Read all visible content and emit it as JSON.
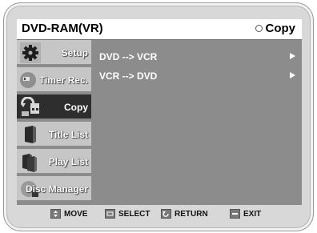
{
  "header": {
    "title": "DVD-RAM(VR)",
    "mode": "Copy",
    "mode_icon": "ring-icon"
  },
  "sidebar": {
    "items": [
      {
        "label": "Setup",
        "icon": "gear-icon",
        "active": false
      },
      {
        "label": "Timer Rec.",
        "icon": "clock-icon",
        "active": false
      },
      {
        "label": "Copy",
        "icon": "copy-icon",
        "active": true
      },
      {
        "label": "Title List",
        "icon": "title-list-icon",
        "active": false
      },
      {
        "label": "Play List",
        "icon": "play-list-icon",
        "active": false
      },
      {
        "label": "Disc Manager",
        "icon": "disc-icon",
        "active": false
      }
    ]
  },
  "menu": {
    "items": [
      {
        "label": "DVD --> VCR"
      },
      {
        "label": "VCR --> DVD"
      }
    ]
  },
  "footer": {
    "move": "MOVE",
    "select": "SELECT",
    "return": "RETURN",
    "exit": "EXIT"
  },
  "colors": {
    "panel": "#8c8c8c",
    "sidebar_item": "#c6c6c6",
    "sidebar_active": "#2e2e2e",
    "title_bar": "#ffffff"
  }
}
